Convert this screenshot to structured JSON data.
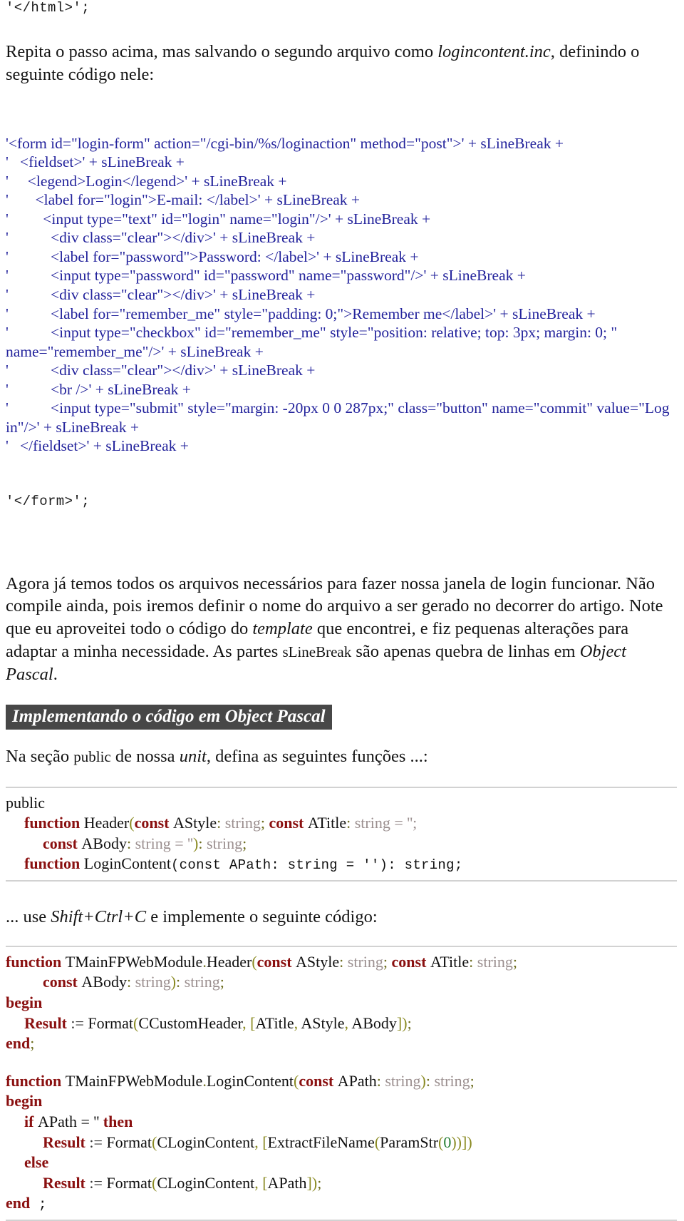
{
  "document": {
    "language": "pt-BR",
    "colors": {
      "html_code": "#23239c",
      "pascal_keyword": "#8a1010",
      "pascal_type": "#9b8f8f",
      "pascal_bracket": "#8a8a22",
      "pascal_number": "#1f7a2e",
      "heading_background": "#474747",
      "heading_text": "#ffffff",
      "rule": "#d2d2d2"
    }
  },
  "top_code_tail": "'</html>';",
  "intro_paragraph": {
    "part1": "Repita o passo acima, mas salvando o segundo arquivo como ",
    "emphasis": "logincontent.inc",
    "part2": ", definindo o seguinte código nele:"
  },
  "html_code_block": {
    "lines": [
      "'<form id=\"login-form\" action=\"/cgi-bin/%s/loginaction\" method=\"post\">' + sLineBreak +",
      "'   <fieldset>' + sLineBreak +",
      "'     <legend>Login</legend>' + sLineBreak +",
      "'       <label for=\"login\">E-mail: </label>' + sLineBreak +",
      "'         <input type=\"text\" id=\"login\" name=\"login\"/>' + sLineBreak +",
      "'           <div class=\"clear\"></div>' + sLineBreak +",
      "'           <label for=\"password\">Password: </label>' + sLineBreak +",
      "'           <input type=\"password\" id=\"password\" name=\"password\"/>' + sLineBreak +",
      "'           <div class=\"clear\"></div>' + sLineBreak +",
      "'           <label for=\"remember_me\" style=\"padding: 0;\">Remember me</label>' + sLineBreak +",
      "'           <input type=\"checkbox\" id=\"remember_me\" style=\"position: relative; top: 3px; margin: 0; \" name=\"remember_me\"/>' + sLineBreak +",
      "'           <div class=\"clear\"></div>' + sLineBreak +",
      "'           <br />' + sLineBreak +",
      "'           <input type=\"submit\" style=\"margin: -20px 0 0 287px;\" class=\"button\" name=\"commit\" value=\"Log in\"/>' + sLineBreak +",
      "'   </fieldset>' + sLineBreak +"
    ],
    "tail": "'</form>';"
  },
  "body_paragraph": {
    "part1": "Agora já temos todos os arquivos necessários para fazer nossa janela de login funcionar. Não compile ainda, pois iremos definir o nome do arquivo a ser gerado no decorrer do artigo. Note que eu aproveitei todo o código do ",
    "em1": "template",
    "part2": " que encontrei, e fiz pequenas alterações para adaptar a minha necessidade. As partes ",
    "code1": "sLineBreak",
    "part3": " são apenas quebra de linhas em ",
    "em2": "Object Pascal",
    "part4": "."
  },
  "section_heading": "Implementando o código em Object Pascal",
  "public_paragraph": {
    "part1": "Na seção ",
    "code1": "public",
    "part2": " de nossa ",
    "em1": "unit",
    "part3": ", defina as seguintes funções ...:"
  },
  "pascal_declaration": {
    "lines": [
      {
        "indent": 0,
        "tokens": [
          {
            "t": "public",
            "c": "ident"
          }
        ]
      },
      {
        "indent": 1,
        "tokens": [
          {
            "t": "function ",
            "c": "kw"
          },
          {
            "t": "Header",
            "c": "ident"
          },
          {
            "t": "(",
            "c": "brk"
          },
          {
            "t": "const ",
            "c": "kw"
          },
          {
            "t": "AStyle",
            "c": "ident"
          },
          {
            "t": ": ",
            "c": "op"
          },
          {
            "t": "string",
            "c": "typ"
          },
          {
            "t": "; ",
            "c": "op"
          },
          {
            "t": "const ",
            "c": "kw"
          },
          {
            "t": "ATitle",
            "c": "ident"
          },
          {
            "t": ": ",
            "c": "op"
          },
          {
            "t": "string = '';",
            "c": "typ"
          }
        ]
      },
      {
        "indent": 2,
        "tokens": [
          {
            "t": "const ",
            "c": "kw"
          },
          {
            "t": "ABody",
            "c": "ident"
          },
          {
            "t": ": ",
            "c": "op"
          },
          {
            "t": "string = ''",
            "c": "typ"
          },
          {
            "t": ")",
            "c": "brk"
          },
          {
            "t": ": ",
            "c": "op"
          },
          {
            "t": "string",
            "c": "typ"
          },
          {
            "t": ";",
            "c": "op"
          }
        ]
      },
      {
        "indent": 1,
        "tokens": [
          {
            "t": "function ",
            "c": "kw"
          },
          {
            "t": "LoginContent",
            "c": "ident"
          },
          {
            "t": "(const APath: string = ''): string;",
            "c": "mono"
          }
        ]
      }
    ]
  },
  "shift_paragraph": {
    "part1": "... use ",
    "em1": "Shift+Ctrl+C",
    "part2": " e implemente o seguinte código:"
  },
  "pascal_header_impl": {
    "lines": [
      {
        "indent": 0,
        "tokens": [
          {
            "t": "function ",
            "c": "kw"
          },
          {
            "t": "TMainFPWebModule",
            "c": "ident"
          },
          {
            "t": ".",
            "c": "op"
          },
          {
            "t": "Header",
            "c": "ident"
          },
          {
            "t": "(",
            "c": "brk"
          },
          {
            "t": "const ",
            "c": "kw"
          },
          {
            "t": "AStyle",
            "c": "ident"
          },
          {
            "t": ": ",
            "c": "op"
          },
          {
            "t": "string",
            "c": "typ"
          },
          {
            "t": "; ",
            "c": "op"
          },
          {
            "t": "const ",
            "c": "kw"
          },
          {
            "t": "ATitle",
            "c": "ident"
          },
          {
            "t": ": ",
            "c": "op"
          },
          {
            "t": "string",
            "c": "typ"
          },
          {
            "t": ";",
            "c": "op"
          }
        ]
      },
      {
        "indent": 2,
        "tokens": [
          {
            "t": "const ",
            "c": "kw"
          },
          {
            "t": "ABody",
            "c": "ident"
          },
          {
            "t": ": ",
            "c": "op"
          },
          {
            "t": "string",
            "c": "typ"
          },
          {
            "t": ")",
            "c": "brk"
          },
          {
            "t": ": ",
            "c": "op"
          },
          {
            "t": "string",
            "c": "typ"
          },
          {
            "t": ";",
            "c": "op"
          }
        ]
      },
      {
        "indent": 0,
        "tokens": [
          {
            "t": "begin",
            "c": "kw"
          }
        ]
      },
      {
        "indent": 1,
        "tokens": [
          {
            "t": "Result ",
            "c": "res"
          },
          {
            "t": ":= ",
            "c": "asgn"
          },
          {
            "t": "Format",
            "c": "ident"
          },
          {
            "t": "(",
            "c": "brk"
          },
          {
            "t": "CCustomHeader",
            "c": "ident"
          },
          {
            "t": ", ",
            "c": "brk"
          },
          {
            "t": "[",
            "c": "brk"
          },
          {
            "t": "ATitle",
            "c": "ident"
          },
          {
            "t": ", ",
            "c": "brk"
          },
          {
            "t": "AStyle",
            "c": "ident"
          },
          {
            "t": ", ",
            "c": "brk"
          },
          {
            "t": "ABody",
            "c": "ident"
          },
          {
            "t": "])",
            "c": "brk"
          },
          {
            "t": ";",
            "c": "op"
          }
        ]
      },
      {
        "indent": 0,
        "tokens": [
          {
            "t": "end",
            "c": "kw"
          },
          {
            "t": ";",
            "c": "op"
          }
        ]
      }
    ]
  },
  "pascal_logincontent_impl": {
    "lines": [
      {
        "indent": 0,
        "tokens": [
          {
            "t": "function ",
            "c": "kw"
          },
          {
            "t": "TMainFPWebModule",
            "c": "ident"
          },
          {
            "t": ".",
            "c": "op"
          },
          {
            "t": "LoginContent",
            "c": "ident"
          },
          {
            "t": "(",
            "c": "brk"
          },
          {
            "t": "const ",
            "c": "kw"
          },
          {
            "t": "APath",
            "c": "ident"
          },
          {
            "t": ": ",
            "c": "op"
          },
          {
            "t": "string",
            "c": "typ"
          },
          {
            "t": ")",
            "c": "brk"
          },
          {
            "t": ": ",
            "c": "op"
          },
          {
            "t": "string",
            "c": "typ"
          },
          {
            "t": ";",
            "c": "op"
          }
        ]
      },
      {
        "indent": 0,
        "tokens": [
          {
            "t": "begin",
            "c": "kw"
          }
        ]
      },
      {
        "indent": 1,
        "tokens": [
          {
            "t": "if ",
            "c": "kw"
          },
          {
            "t": "APath = '' ",
            "c": "ident"
          },
          {
            "t": "then",
            "c": "kw"
          }
        ]
      },
      {
        "indent": 2,
        "tokens": [
          {
            "t": "Result ",
            "c": "res"
          },
          {
            "t": ":= ",
            "c": "asgn"
          },
          {
            "t": "Format",
            "c": "ident"
          },
          {
            "t": "(",
            "c": "brk"
          },
          {
            "t": "CLoginContent",
            "c": "ident"
          },
          {
            "t": ", ",
            "c": "brk"
          },
          {
            "t": "[",
            "c": "brk"
          },
          {
            "t": "ExtractFileName",
            "c": "ident"
          },
          {
            "t": "(",
            "c": "brk"
          },
          {
            "t": "ParamStr",
            "c": "ident"
          },
          {
            "t": "(",
            "c": "brk"
          },
          {
            "t": "0",
            "c": "num"
          },
          {
            "t": "))])",
            "c": "brk"
          }
        ]
      },
      {
        "indent": 1,
        "tokens": [
          {
            "t": "else",
            "c": "kw"
          }
        ]
      },
      {
        "indent": 2,
        "tokens": [
          {
            "t": "Result ",
            "c": "res"
          },
          {
            "t": ":= ",
            "c": "asgn"
          },
          {
            "t": "Format",
            "c": "ident"
          },
          {
            "t": "(",
            "c": "brk"
          },
          {
            "t": "CLoginContent",
            "c": "ident"
          },
          {
            "t": ", ",
            "c": "brk"
          },
          {
            "t": "[",
            "c": "brk"
          },
          {
            "t": "APath",
            "c": "ident"
          },
          {
            "t": "])",
            "c": "brk"
          },
          {
            "t": ";",
            "c": "op"
          }
        ]
      },
      {
        "indent": 0,
        "tokens": [
          {
            "t": "end",
            "c": "kw"
          },
          {
            "t": " ;",
            "c": "mono"
          }
        ]
      }
    ]
  }
}
